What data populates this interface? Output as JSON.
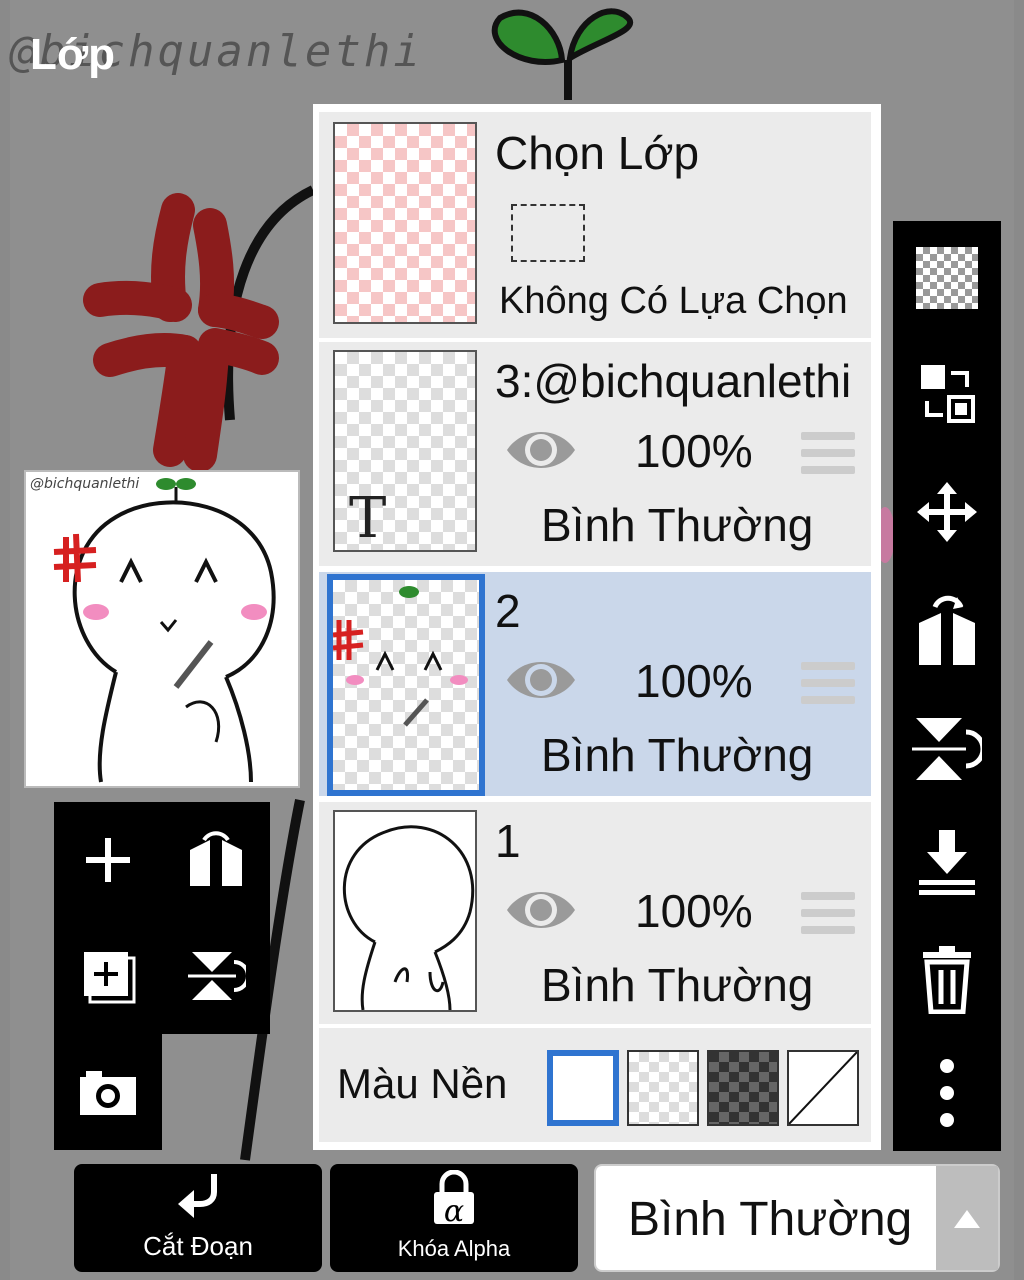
{
  "header": {
    "title": "Lớp",
    "watermark": "@bichquanlethi"
  },
  "preview": {
    "watermark": "@bichquanlethi"
  },
  "selection_layer": {
    "title": "Chọn Lớp",
    "status": "Không Có Lựa Chọn"
  },
  "layers": [
    {
      "name": "3:@bichquanlethi",
      "opacity": "100%",
      "blend": "Bình Thường",
      "type_badge": "T",
      "selected": false
    },
    {
      "name": "2",
      "opacity": "100%",
      "blend": "Bình Thường",
      "selected": true
    },
    {
      "name": "1",
      "opacity": "100%",
      "blend": "Bình Thường",
      "selected": false
    }
  ],
  "background": {
    "label": "Màu Nền",
    "options": [
      "white",
      "transparent-light",
      "transparent-dark",
      "none"
    ],
    "selected": "white"
  },
  "left_tools": [
    "add-layer",
    "flip-horizontal",
    "duplicate-layer",
    "flip-vertical",
    "camera"
  ],
  "right_tools": [
    "checker-transparency",
    "swap-layers",
    "move",
    "flip-horizontal",
    "flip-vertical",
    "merge-down",
    "delete",
    "more"
  ],
  "bottom": {
    "clip_label": "Cắt Đoạn",
    "alpha_lock_label": "Khóa Alpha",
    "alpha_glyph": "α",
    "blend_mode": "Bình Thường"
  },
  "colors": {
    "accent": "#2f74d0",
    "selected_row": "#cad7ea",
    "row": "#ebebeb",
    "toolbar": "#000000",
    "anger_red": "#8b1c1c",
    "sprout_green": "#2e8b2e"
  }
}
